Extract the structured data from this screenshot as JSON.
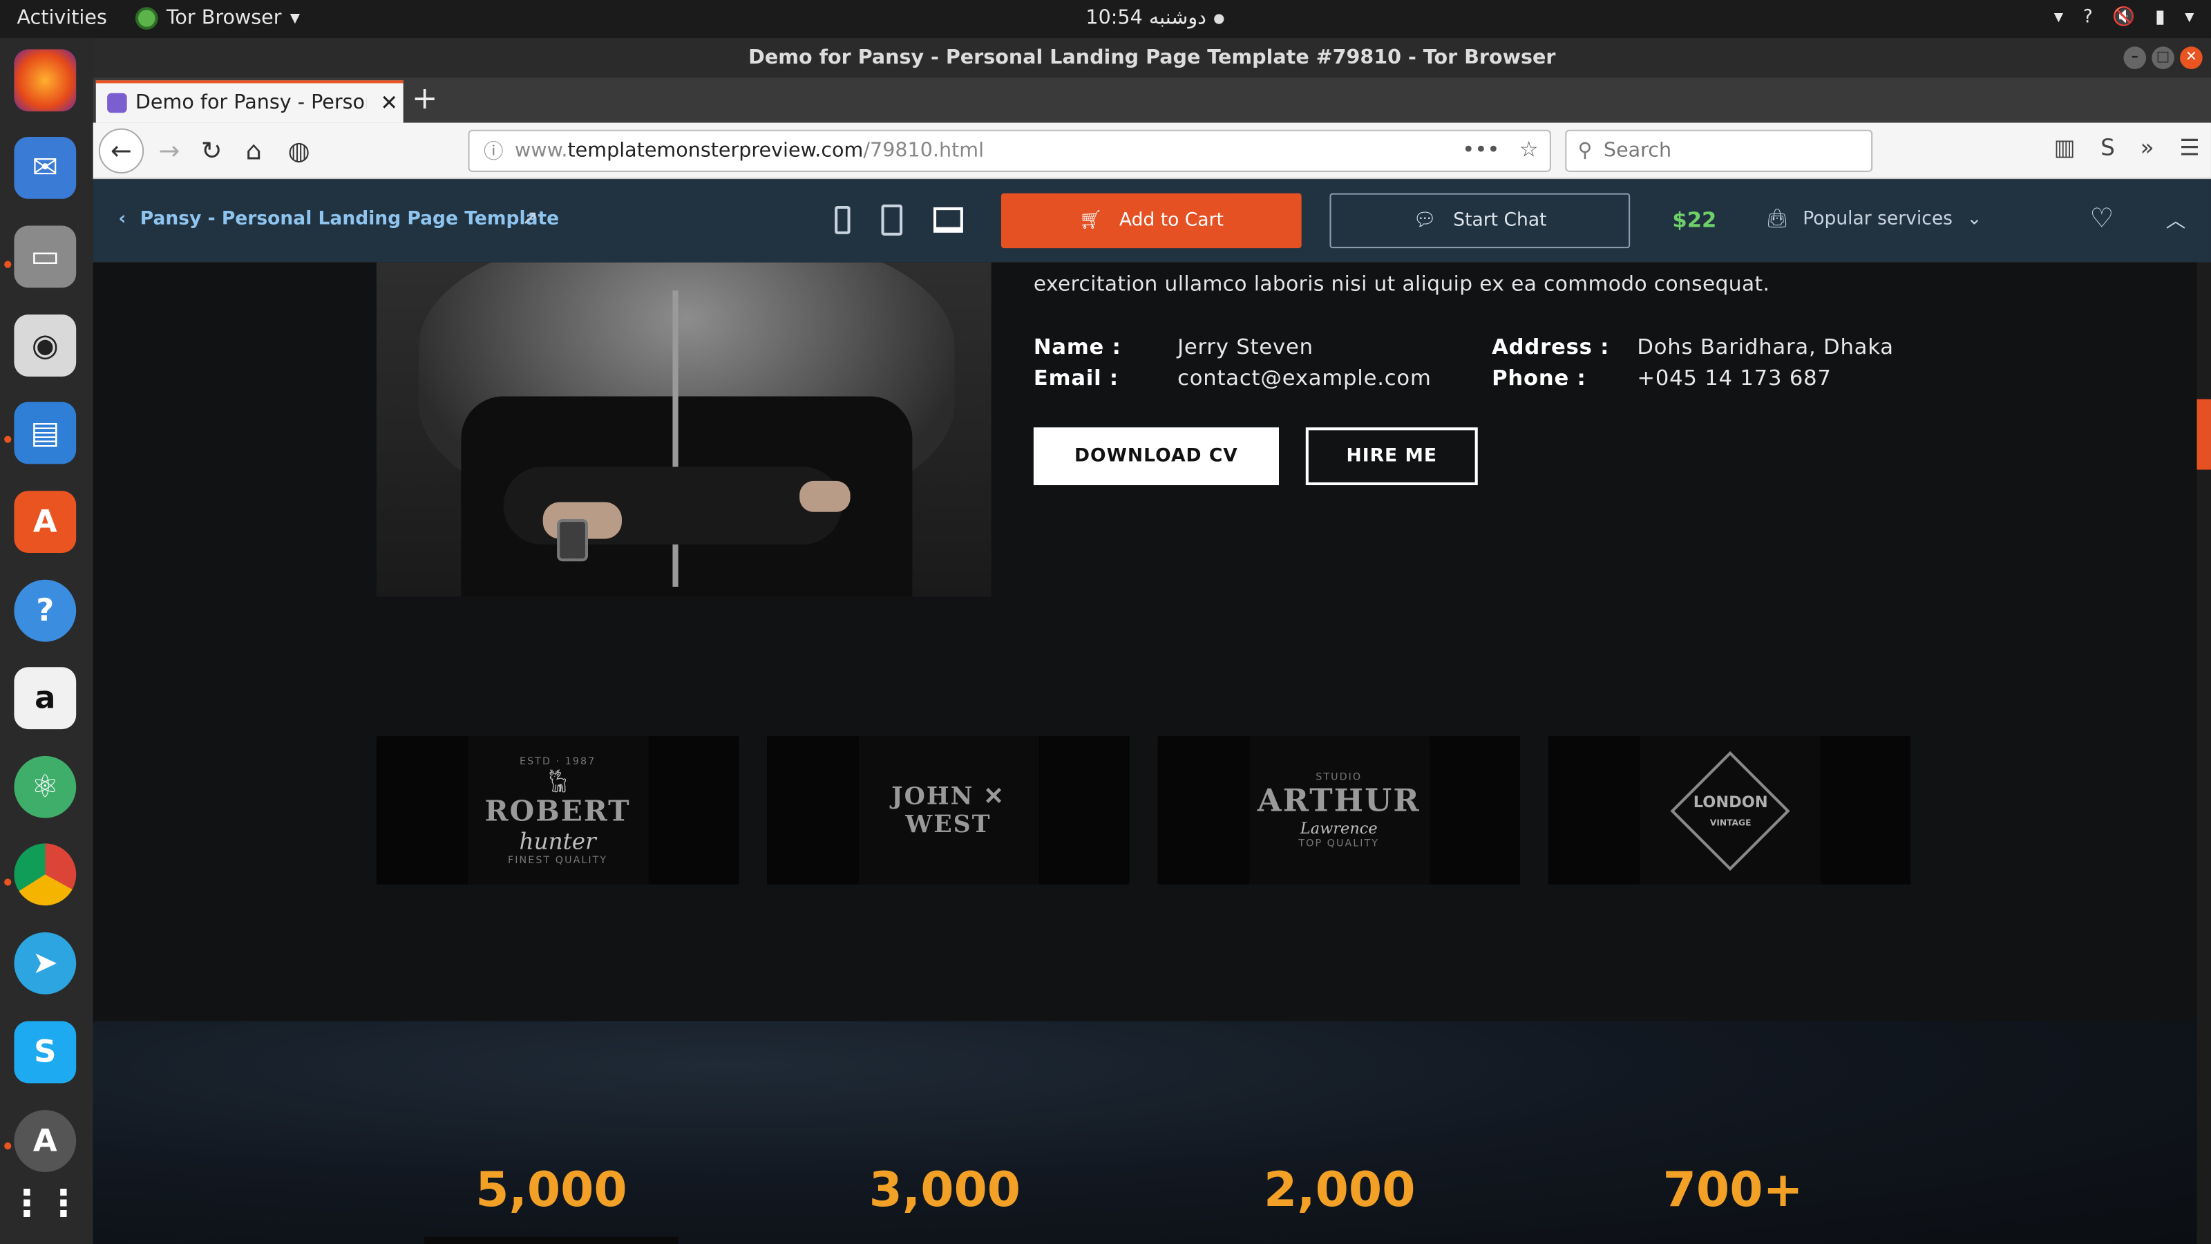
{
  "system": {
    "activities": "Activities",
    "app_name": "Tor Browser",
    "clock": "10:54 دوشنبه"
  },
  "window": {
    "title": "Demo for Pansy - Personal Landing Page Template #79810 - Tor Browser"
  },
  "browser": {
    "tab_title": "Demo for Pansy - Person",
    "url_prefix": "www.",
    "url_host": "templatemonsterpreview.com",
    "url_path": "/79810.html",
    "search_placeholder": "Search"
  },
  "preview_toolbar": {
    "back_label": "Pansy - Personal Landing Page Template",
    "add_to_cart": "Add to Cart",
    "start_chat": "Start Chat",
    "price": "$22",
    "popular_services": "Popular services"
  },
  "about": {
    "intro_line": "exercitation ullamco laboris nisi ut aliquip ex ea commodo consequat.",
    "name_label": "Name :",
    "name_value": "Jerry Steven",
    "email_label": "Email :",
    "email_value": "contact@example.com",
    "address_label": "Address :",
    "address_value": "Dohs Baridhara, Dhaka",
    "phone_label": "Phone :",
    "phone_value": "+045 14 173 687",
    "download_cv": "DOWNLOAD CV",
    "hire_me": "HIRE ME"
  },
  "clients": [
    {
      "top": "ESTD · 1987",
      "big": "ROBERT",
      "script": "hunter",
      "bottom": "FINEST QUALITY"
    },
    {
      "top": "",
      "big": "JOHN ✕ WEST",
      "script": "",
      "bottom": ""
    },
    {
      "top": "STUDIO",
      "big": "ARTHUR",
      "script": "Lawrence",
      "bottom": "TOP QUALITY"
    },
    {
      "top": "",
      "big": "LONDON",
      "script": "",
      "bottom": "VINTAGE"
    }
  ],
  "stats": [
    "5,000",
    "3,000",
    "2,000",
    "700+"
  ],
  "colors": {
    "accent": "#e65124",
    "stat_color": "#f2a126",
    "price_color": "#6ed068",
    "toolbar_bg": "#213241"
  }
}
